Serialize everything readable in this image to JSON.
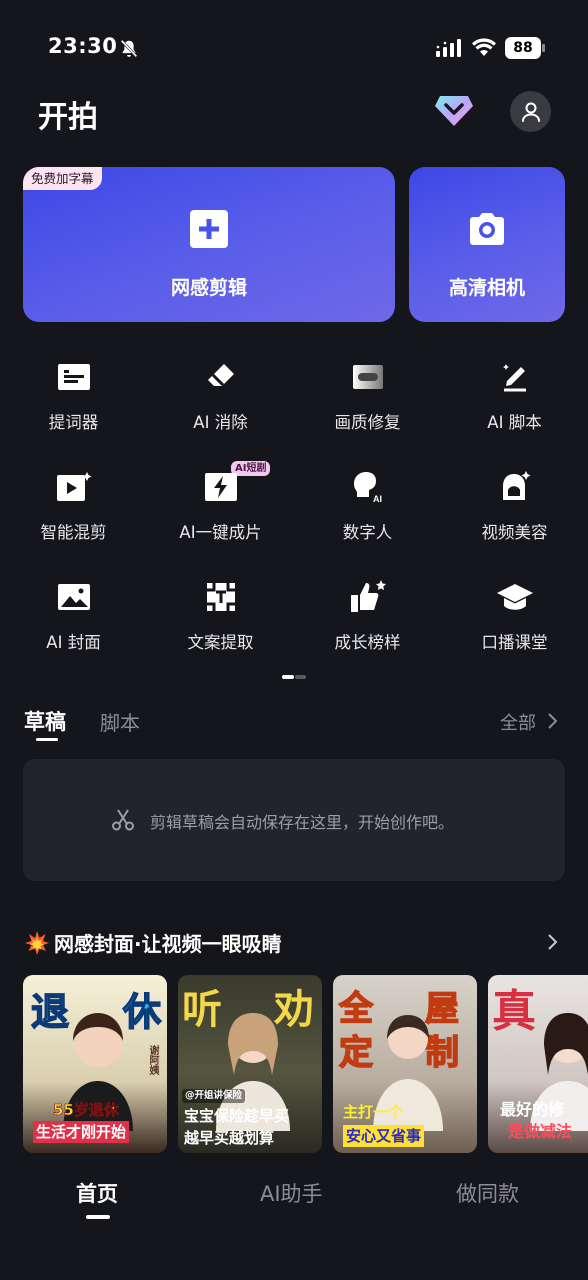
{
  "status_bar": {
    "time": "23:30",
    "battery": "88"
  },
  "header": {
    "title": "开拍"
  },
  "hero": {
    "main_badge": "免费加字幕",
    "main_label": "网感剪辑",
    "camera_label": "高清相机",
    "gradient_start": "#3d47e6",
    "gradient_end": "#7068e8"
  },
  "tools": [
    {
      "label": "提词器",
      "icon": "teleprompter-icon"
    },
    {
      "label": "AI 消除",
      "icon": "eraser-icon"
    },
    {
      "label": "画质修复",
      "icon": "quality-repair-icon"
    },
    {
      "label": "AI 脚本",
      "icon": "ai-script-icon"
    },
    {
      "label": "智能混剪",
      "icon": "smart-mix-icon"
    },
    {
      "label": "AI一键成片",
      "icon": "one-click-video-icon",
      "badge": "AI短剧"
    },
    {
      "label": "数字人",
      "icon": "digital-human-icon"
    },
    {
      "label": "视频美容",
      "icon": "video-beauty-icon"
    },
    {
      "label": "AI 封面",
      "icon": "ai-cover-icon"
    },
    {
      "label": "文案提取",
      "icon": "text-extract-icon"
    },
    {
      "label": "成长榜样",
      "icon": "growth-thumb-icon"
    },
    {
      "label": "口播课堂",
      "icon": "graduation-cap-icon"
    }
  ],
  "drafts": {
    "tab_draft": "草稿",
    "tab_script": "脚本",
    "all_label": "全部",
    "empty_hint": "剪辑草稿会自动保存在这里，开始创作吧。"
  },
  "covers": {
    "title": "网感封面·让视频一眼吸睛",
    "items": [
      {
        "big_left": "退",
        "big_right": "休",
        "stamp": "谢阿姨",
        "cap1": "55岁退休",
        "cap2": "生活才刚开始"
      },
      {
        "big_left": "听",
        "big_right": "劝",
        "tag": "@开姐讲保险",
        "cap1": "宝宝保险趁早买",
        "cap2": "越早买越划算"
      },
      {
        "big_left": "全",
        "big_right": "屋",
        "big_left2": "定",
        "big_right2": "制",
        "cap1": "主打一个",
        "cap2": "安心又省事"
      },
      {
        "big_left": "真",
        "cap1": "最好的修",
        "cap2": "是做减法"
      }
    ]
  },
  "nav": {
    "home": "首页",
    "ai": "AI助手",
    "same": "做同款"
  }
}
